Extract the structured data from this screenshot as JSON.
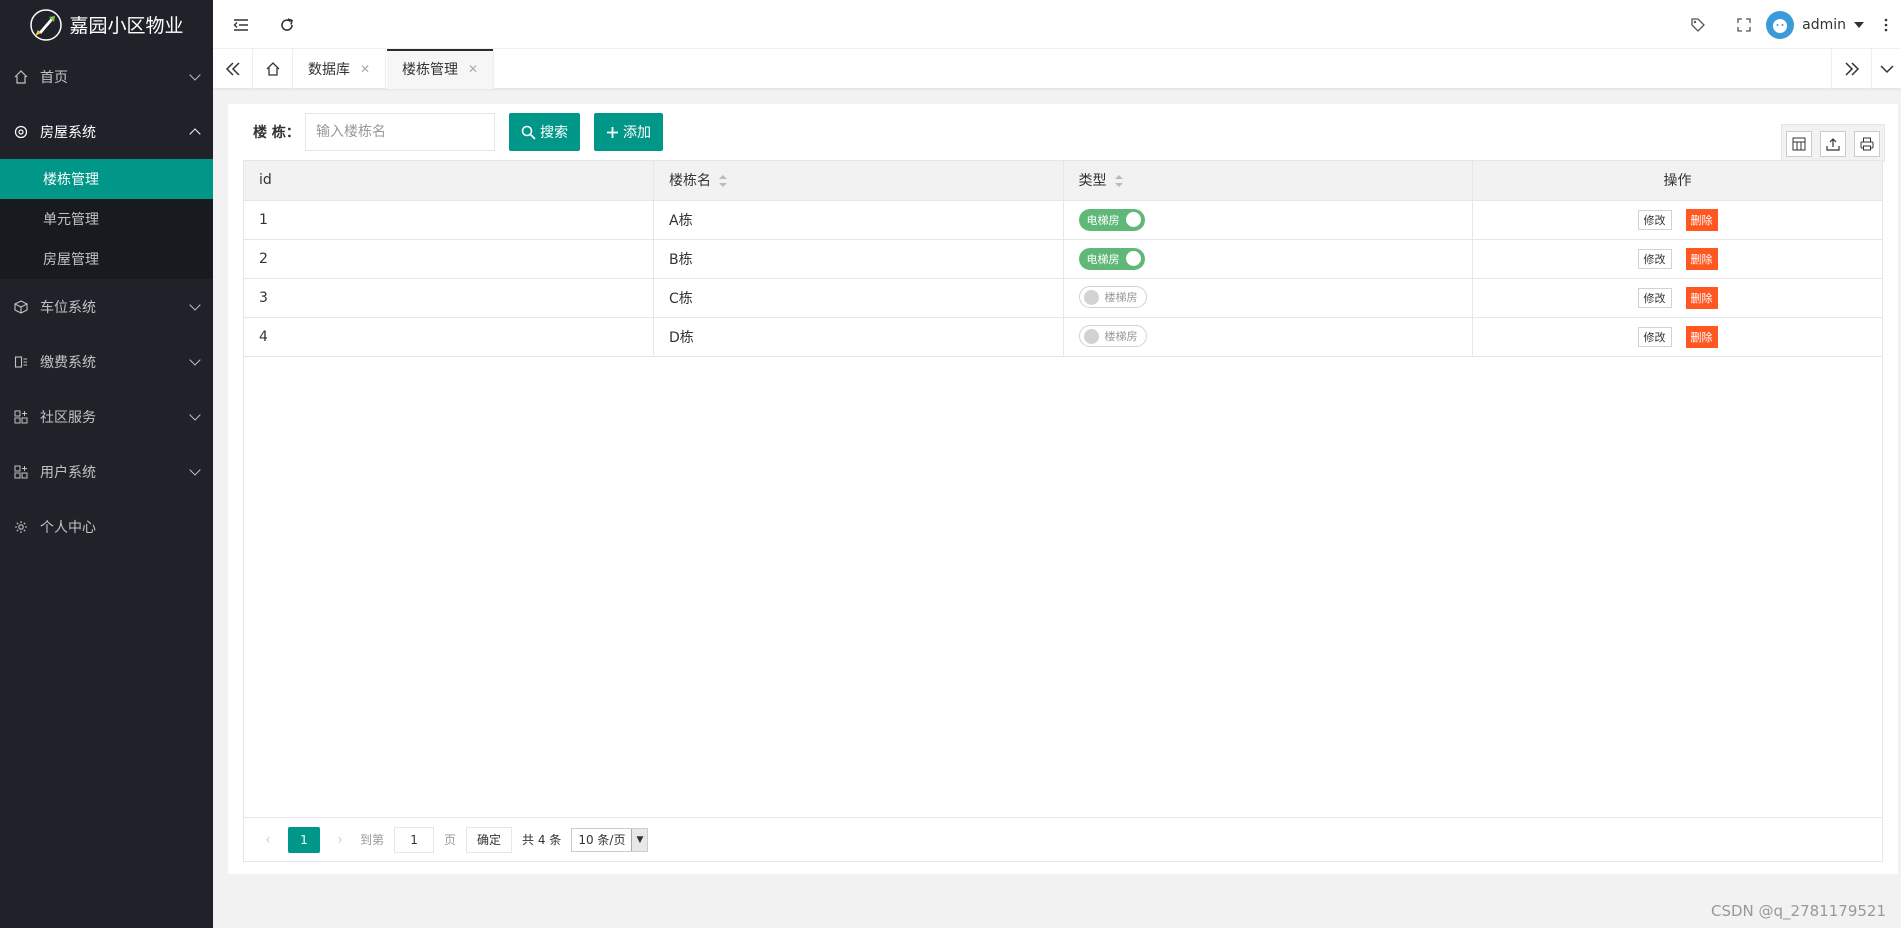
{
  "app": {
    "title": "嘉园小区物业"
  },
  "sidebar": {
    "items": [
      {
        "label": "首页",
        "icon": "home-icon",
        "expanded": false
      },
      {
        "label": "房屋系统",
        "icon": "gear-icon",
        "expanded": true,
        "children": [
          {
            "label": "楼栋管理",
            "active": true
          },
          {
            "label": "单元管理"
          },
          {
            "label": "房屋管理"
          }
        ]
      },
      {
        "label": "车位系统",
        "icon": "cube-icon",
        "expanded": false
      },
      {
        "label": "缴费系统",
        "icon": "bill-icon",
        "expanded": false
      },
      {
        "label": "社区服务",
        "icon": "apps-icon",
        "expanded": false
      },
      {
        "label": "用户系统",
        "icon": "apps-icon",
        "expanded": false
      },
      {
        "label": "个人中心",
        "icon": "settings-icon",
        "expanded": false
      }
    ]
  },
  "header": {
    "user": "admin"
  },
  "tabs": [
    {
      "label": "数据库",
      "active": false
    },
    {
      "label": "楼栋管理",
      "active": true
    }
  ],
  "search": {
    "label": "楼 栋：",
    "placeholder": "输入楼栋名",
    "search_button": "搜索",
    "add_button": "添加"
  },
  "table": {
    "columns": [
      "id",
      "楼栋名",
      "类型",
      "操作"
    ],
    "rows": [
      {
        "id": "1",
        "name": "A栋",
        "type": "电梯房",
        "type_on": true
      },
      {
        "id": "2",
        "name": "B栋",
        "type": "电梯房",
        "type_on": true
      },
      {
        "id": "3",
        "name": "C栋",
        "type": "楼梯房",
        "type_on": false
      },
      {
        "id": "4",
        "name": "D栋",
        "type": "楼梯房",
        "type_on": false
      }
    ],
    "edit_label": "修改",
    "delete_label": "删除"
  },
  "pager": {
    "current": "1",
    "goto_prefix": "到第",
    "goto_value": "1",
    "goto_suffix": "页",
    "confirm": "确定",
    "total": "共 4 条",
    "page_size": "10 条/页"
  },
  "watermark": "CSDN @q_2781179521",
  "colors": {
    "accent": "#009688",
    "sidebar": "#20222a",
    "switch_on": "#5FB878",
    "danger": "#FF5722"
  }
}
